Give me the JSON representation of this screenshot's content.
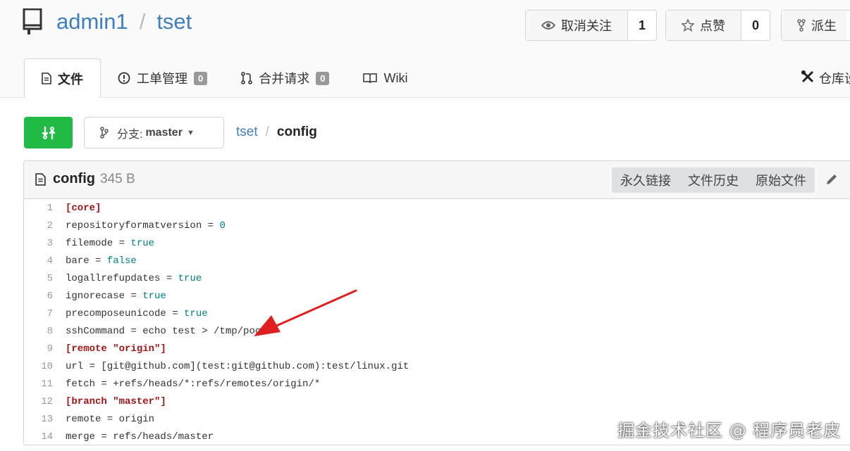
{
  "repo": {
    "owner": "admin1",
    "separator": "/",
    "name": "tset"
  },
  "actions": {
    "watch": {
      "label": "取消关注",
      "count": "1"
    },
    "star": {
      "label": "点赞",
      "count": "0"
    },
    "fork": {
      "label": "派生"
    }
  },
  "tabs": [
    {
      "label": "文件",
      "active": true
    },
    {
      "label": "工单管理",
      "badge": "0"
    },
    {
      "label": "合并请求",
      "badge": "0"
    },
    {
      "label": "Wiki"
    }
  ],
  "settings_tab": {
    "label": "仓库设置"
  },
  "branch": {
    "prefix": "分支:",
    "name": "master"
  },
  "breadcrumb": {
    "repo": "tset",
    "separator": "/",
    "file": "config"
  },
  "file": {
    "name": "config",
    "size": "345 B",
    "actions": [
      "永久链接",
      "文件历史",
      "原始文件"
    ]
  },
  "code_lines": [
    {
      "n": "1",
      "parts": [
        {
          "t": "[core]",
          "c": "sec"
        }
      ]
    },
    {
      "n": "2",
      "parts": [
        {
          "t": "repositoryformatversion = "
        },
        {
          "t": "0",
          "c": "val"
        }
      ]
    },
    {
      "n": "3",
      "parts": [
        {
          "t": "filemode = "
        },
        {
          "t": "true",
          "c": "val"
        }
      ]
    },
    {
      "n": "4",
      "parts": [
        {
          "t": "bare = "
        },
        {
          "t": "false",
          "c": "val"
        }
      ]
    },
    {
      "n": "5",
      "parts": [
        {
          "t": "logallrefupdates = "
        },
        {
          "t": "true",
          "c": "val"
        }
      ]
    },
    {
      "n": "6",
      "parts": [
        {
          "t": "ignorecase = "
        },
        {
          "t": "true",
          "c": "val"
        }
      ]
    },
    {
      "n": "7",
      "parts": [
        {
          "t": "precomposeunicode = "
        },
        {
          "t": "true",
          "c": "val"
        }
      ]
    },
    {
      "n": "8",
      "parts": [
        {
          "t": "sshCommand = echo test > /tmp/poc"
        }
      ]
    },
    {
      "n": "9",
      "parts": [
        {
          "t": "[remote \"origin\"]",
          "c": "sec"
        }
      ]
    },
    {
      "n": "10",
      "parts": [
        {
          "t": "url = [git@github.com](test:git@github.com):test/linux.git"
        }
      ]
    },
    {
      "n": "11",
      "parts": [
        {
          "t": "fetch = +refs/heads/*:refs/remotes/origin/*"
        }
      ]
    },
    {
      "n": "12",
      "parts": [
        {
          "t": "[branch \"master\"]",
          "c": "sec"
        }
      ]
    },
    {
      "n": "13",
      "parts": [
        {
          "t": "remote = origin"
        }
      ]
    },
    {
      "n": "14",
      "parts": [
        {
          "t": "merge = refs/heads/master"
        }
      ]
    }
  ],
  "watermark": "掘金技术社区 @ 程序员老皮",
  "colors": {
    "link": "#3f7fbd",
    "primary_green": "#21ba45",
    "section": "#a31515",
    "value": "#008080",
    "arrow": "#e02020"
  }
}
